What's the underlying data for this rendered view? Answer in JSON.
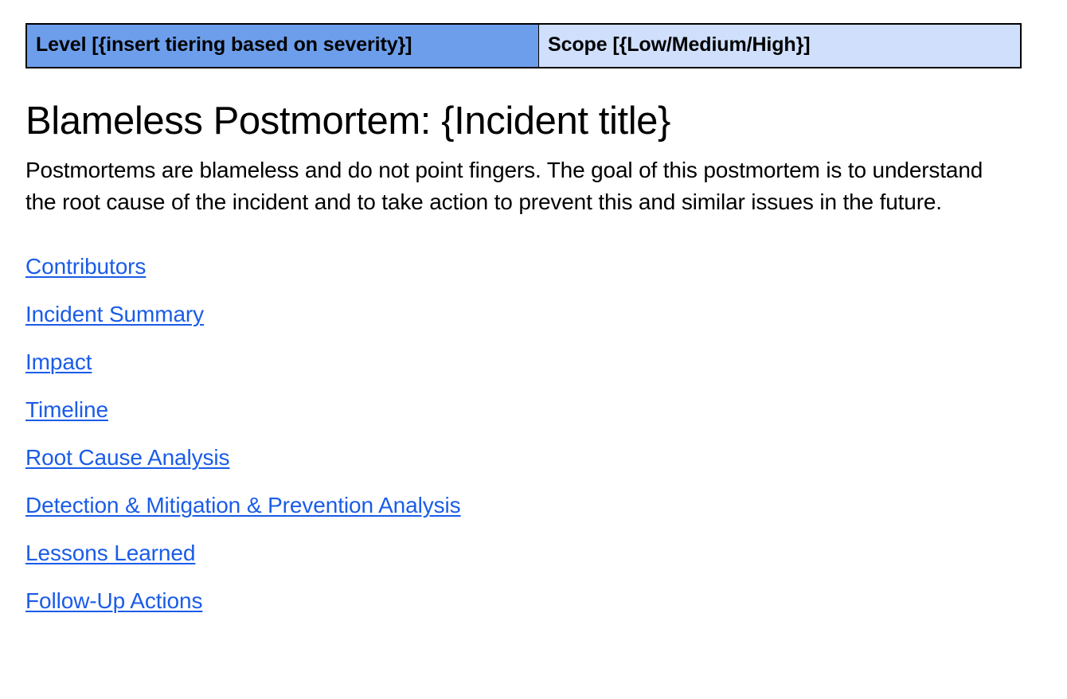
{
  "document": {
    "severity_table": {
      "columns": [
        {
          "name": "level",
          "label": "Level [{insert tiering based on severity}]",
          "background": "#6d9eeb"
        },
        {
          "name": "scope",
          "label": "Scope [{Low/Medium/High}]",
          "background": "#cfdffc"
        }
      ],
      "border_color": "#000000"
    },
    "title": "Blameless Postmortem: {Incident title}",
    "intro": "Postmortems are blameless and do not point fingers. The goal of this postmortem is to understand the root cause of the incident and to take action to prevent this and similar issues in the future.",
    "link_color": "#1a5ce8",
    "toc": [
      {
        "label": "Contributors"
      },
      {
        "label": "Incident Summary"
      },
      {
        "label": "Impact"
      },
      {
        "label": "Timeline"
      },
      {
        "label": "Root Cause Analysis"
      },
      {
        "label": "Detection & Mitigation & Prevention Analysis"
      },
      {
        "label": "Lessons Learned"
      },
      {
        "label": "Follow-Up Actions"
      }
    ]
  }
}
